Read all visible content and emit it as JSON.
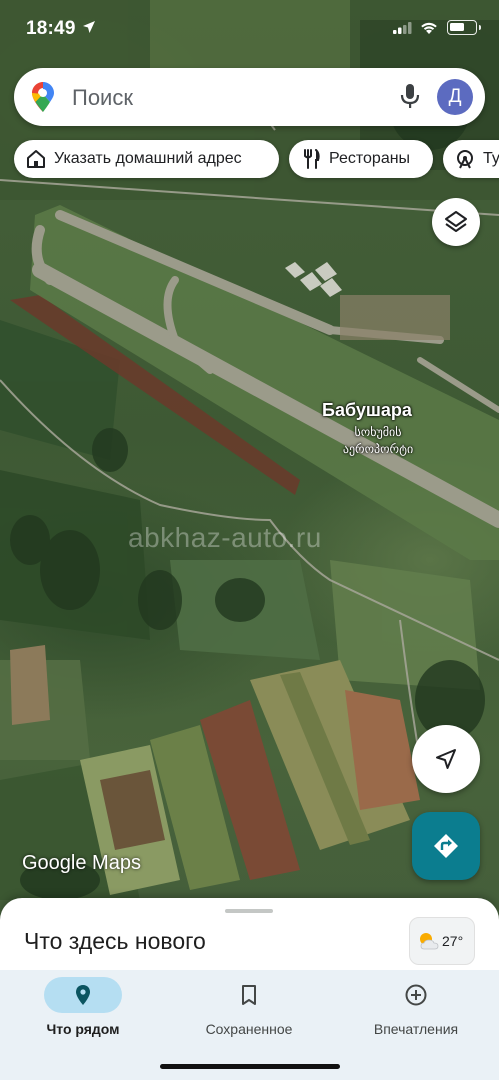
{
  "status_bar": {
    "time": "18:49",
    "icons": [
      "location-arrow-icon",
      "cellular-signal-icon",
      "wifi-icon",
      "battery-icon"
    ]
  },
  "search": {
    "placeholder": "Поиск",
    "avatar_letter": "Д",
    "icons": [
      "google-maps-pin-icon",
      "microphone-icon"
    ]
  },
  "chips": [
    {
      "label": "Указать домашний адрес",
      "icon": "home-icon"
    },
    {
      "label": "Рестораны",
      "icon": "fork-knife-icon"
    },
    {
      "label": "Ту",
      "icon": "ferris-wheel-icon"
    }
  ],
  "map": {
    "place_name": "Бабушара",
    "place_subtitle": "სოხუმის აეროპორტი",
    "watermark": "abkhaz-auto.ru",
    "attribution": "Google Maps",
    "colors": {
      "tile_base": "#46613a",
      "runway": "#9b9b8a",
      "soil": "#6b3a2a"
    }
  },
  "floating_buttons": {
    "layers": "layers-icon",
    "my_location": "navigation-arrow-icon",
    "directions": "directions-icon",
    "directions_color": "#0b7d8f"
  },
  "bottom_sheet": {
    "title": "Что здесь нового",
    "weather": {
      "temp": "27°",
      "icon": "partly-sunny-icon"
    }
  },
  "nav": {
    "items": [
      {
        "label": "Что рядом",
        "icon": "location-pin-icon",
        "active": true
      },
      {
        "label": "Сохраненное",
        "icon": "bookmark-icon",
        "active": false
      },
      {
        "label": "Впечатления",
        "icon": "add-circle-icon",
        "active": false
      }
    ],
    "active_color": "#b5def2"
  }
}
